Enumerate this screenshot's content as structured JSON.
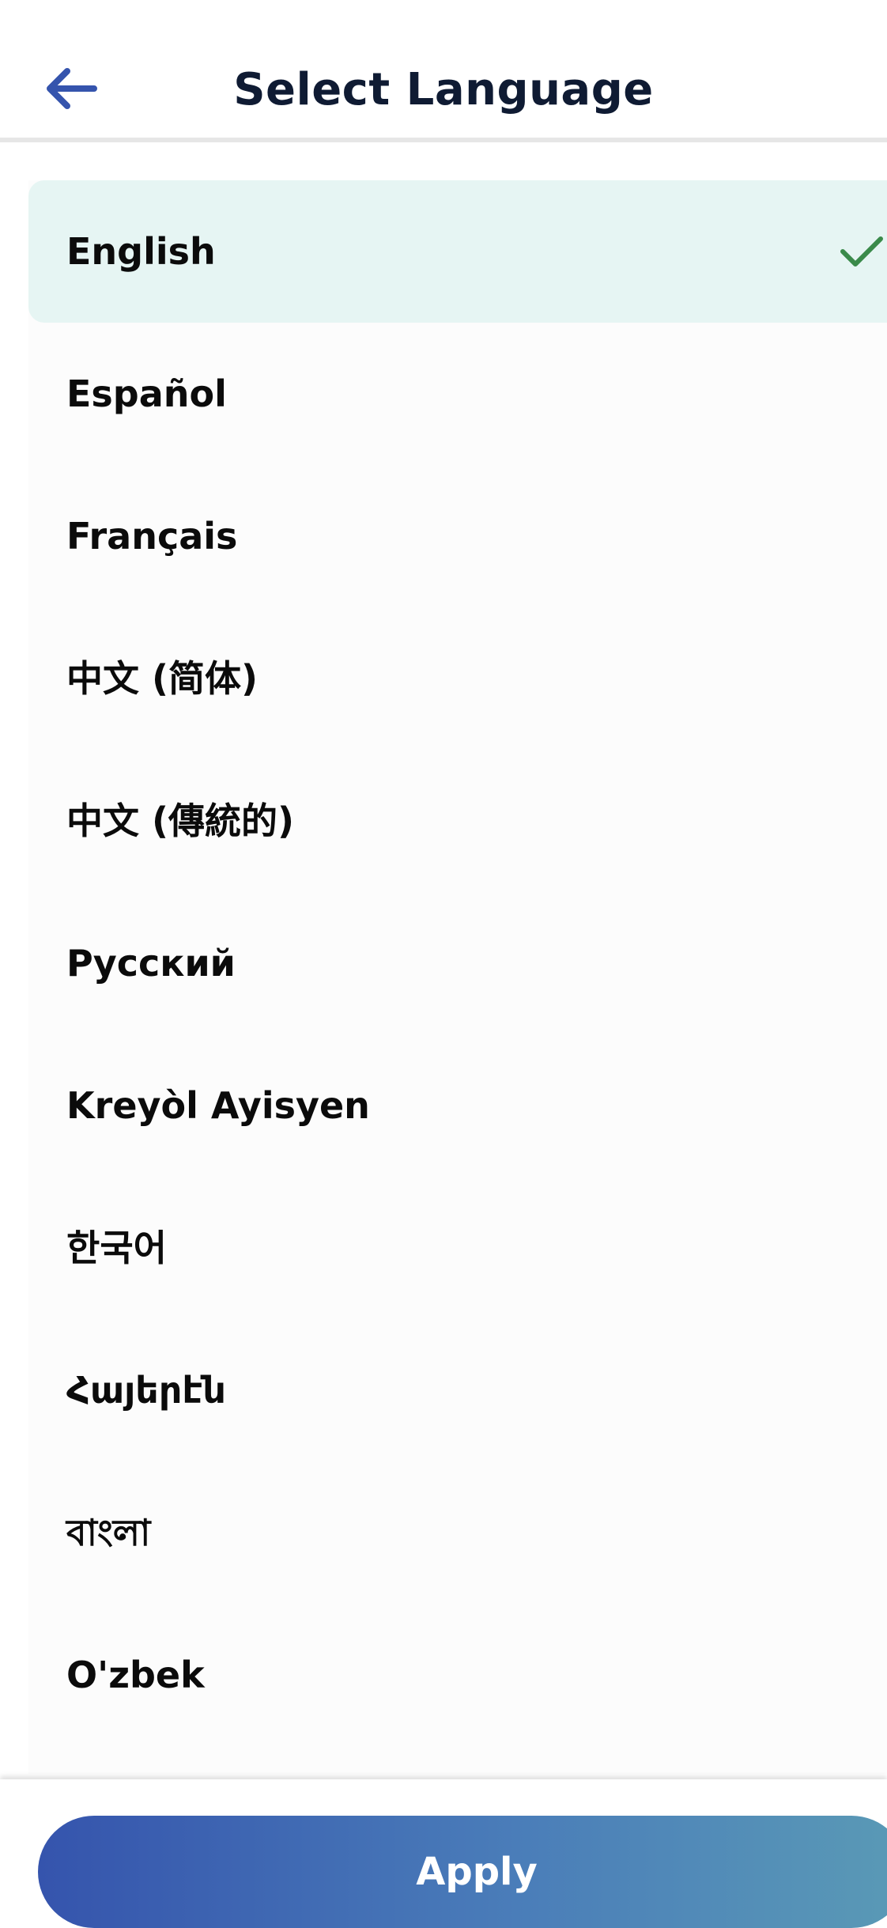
{
  "header": {
    "title": "Select Language",
    "back_icon": "arrow-left-icon"
  },
  "languages": [
    {
      "label": "English",
      "selected": true
    },
    {
      "label": "Español",
      "selected": false
    },
    {
      "label": "Français",
      "selected": false
    },
    {
      "label": "中文 (简体)",
      "selected": false
    },
    {
      "label": "中文 (傳統的)",
      "selected": false
    },
    {
      "label": "Русский",
      "selected": false
    },
    {
      "label": "Kreyòl Ayisyen",
      "selected": false
    },
    {
      "label": "한국어",
      "selected": false
    },
    {
      "label": "Հայերէն",
      "selected": false
    },
    {
      "label": "বাংলা",
      "selected": false
    },
    {
      "label": "O'zbek",
      "selected": false
    }
  ],
  "selected_icon": "checkmark-icon",
  "footer": {
    "apply_label": "Apply"
  },
  "colors": {
    "accent": "#3554ad",
    "selected_bg": "#e6f5f3",
    "check": "#3a8a4a",
    "title": "#0f1b33"
  }
}
